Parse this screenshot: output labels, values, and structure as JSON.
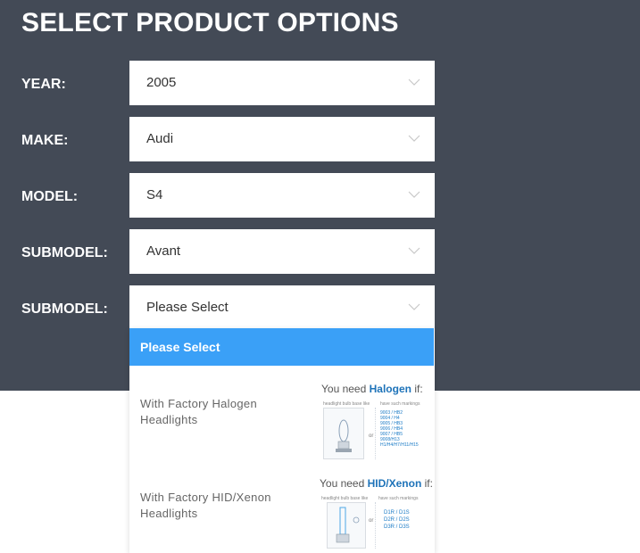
{
  "title": "SELECT PRODUCT OPTIONS",
  "fields": [
    {
      "label": "YEAR:",
      "value": "2005"
    },
    {
      "label": "MAKE:",
      "value": "Audi"
    },
    {
      "label": "MODEL:",
      "value": "S4"
    },
    {
      "label": "SUBMODEL:",
      "value": "Avant"
    },
    {
      "label": "SUBMODEL:",
      "value": "Please Select"
    }
  ],
  "dropdown": {
    "selected_option": "Please Select",
    "options": [
      {
        "label": "With Factory Halogen Headlights",
        "info_prefix": "You need",
        "info_type": "Halogen",
        "info_suffix": "if:",
        "caption_left": "headlight bulb base like",
        "caption_right": "have such markings",
        "or": "or",
        "codes": [
          "9003 / HB2",
          "9004 / H4",
          "9005 / HB3",
          "9006 / HB4",
          "9007 / HB5",
          "9008/H13",
          "H1/H4/H7/H11/H15"
        ]
      },
      {
        "label": "With Factory HID/Xenon Headlights",
        "info_prefix": "You need",
        "info_type": "HID/Xenon",
        "info_suffix": "if:",
        "caption_left": "headlight bulb base like",
        "caption_right": "have such markings",
        "or": "or",
        "codes": [
          "D1R / D1S",
          "D2R / D2S",
          "D3R / D3S"
        ]
      }
    ]
  },
  "icons": {
    "chevron": "chevron-down-icon",
    "bulb": "bulb-icon"
  },
  "colors": {
    "panel": "#434a56",
    "highlight": "#3aa0f7",
    "accent_text": "#1e73b9"
  }
}
